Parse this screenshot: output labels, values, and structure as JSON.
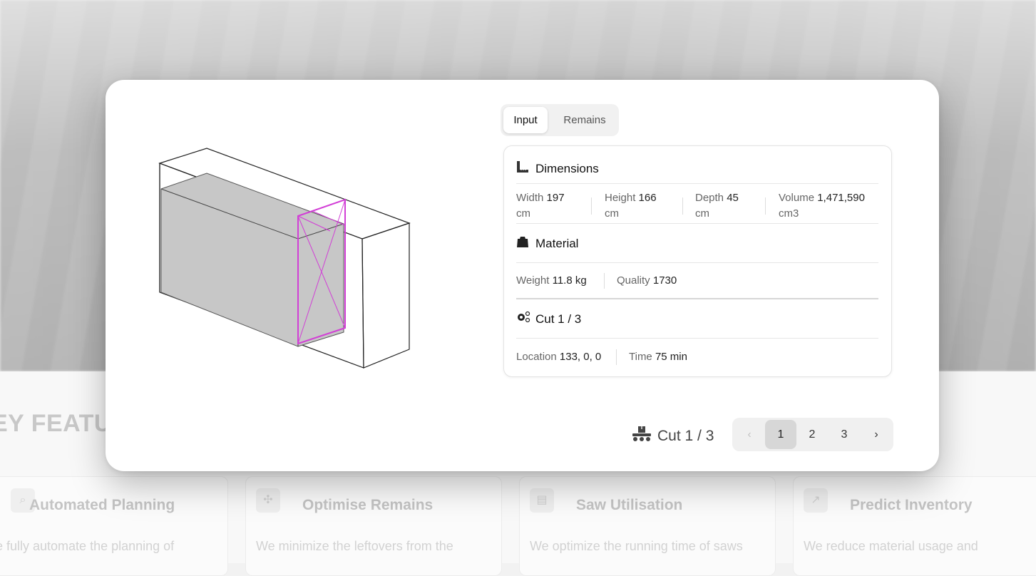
{
  "background": {
    "section_title": "EY FEATU",
    "features": [
      {
        "icon": "planning-icon",
        "title": "Automated Planning",
        "desc": "e fully automate the planning of"
      },
      {
        "icon": "remains-icon",
        "title": "Optimise Remains",
        "desc": "We minimize the leftovers from the"
      },
      {
        "icon": "saw-icon",
        "title": "Saw Utilisation",
        "desc": "We optimize the running time of saws"
      },
      {
        "icon": "inventory-icon",
        "title": "Predict Inventory",
        "desc": "We reduce material usage and"
      }
    ]
  },
  "modal": {
    "tabs": [
      {
        "label": "Input",
        "active": true
      },
      {
        "label": "Remains",
        "active": false
      }
    ],
    "dimensions": {
      "heading": "Dimensions",
      "icon": "ruler-icon",
      "width_label": "Width",
      "width_value": "197",
      "width_unit": "cm",
      "height_label": "Height",
      "height_value": "166",
      "height_unit": "cm",
      "depth_label": "Depth",
      "depth_value": "45",
      "depth_unit": "cm",
      "volume_label": "Volume",
      "volume_value": "1,471,590",
      "volume_unit": "cm3"
    },
    "material": {
      "heading": "Material",
      "icon": "weight-icon",
      "weight_label": "Weight",
      "weight_value": "11.8 kg",
      "quality_label": "Quality",
      "quality_value": "1730"
    },
    "cut": {
      "heading": "Cut 1 / 3",
      "icon": "gears-icon",
      "location_label": "Location",
      "location_value": "133, 0, 0",
      "time_label": "Time",
      "time_value": "75 min"
    },
    "footer": {
      "label": "Cut 1 / 3",
      "icon": "conveyor-icon",
      "prev": "‹",
      "pages": [
        "1",
        "2",
        "3"
      ],
      "current_page": "1",
      "next": "›"
    },
    "colors": {
      "cut_highlight": "#d23fd6",
      "block_fill": "#c7c7c7",
      "outline": "#222222"
    }
  }
}
